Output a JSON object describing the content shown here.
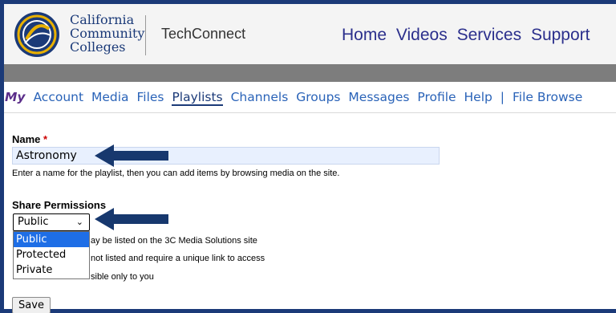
{
  "header": {
    "logo": {
      "lines": [
        "California",
        "Community",
        "Colleges"
      ]
    },
    "brand": "TechConnect",
    "nav": [
      "Home",
      "Videos",
      "Services",
      "Support"
    ]
  },
  "subnav": {
    "my": "My",
    "items": [
      "Account",
      "Media",
      "Files",
      "Playlists",
      "Channels",
      "Groups",
      "Messages",
      "Profile",
      "Help"
    ],
    "separator": "|",
    "trailing": "File Browse",
    "active": "Playlists"
  },
  "form": {
    "name_label": "Name",
    "required_mark": "*",
    "name_value": "Astronomy",
    "name_help": "Enter a name for the playlist, then you can add items by browsing media on the site.",
    "share_label": "Share Permissions",
    "share_selected": "Public",
    "share_options": [
      "Public",
      "Protected",
      "Private"
    ],
    "help_line1_visible": "ay be listed on the 3C Media Solutions site",
    "help_line2_visible": "not listed and require a unique link to access",
    "help_line3_visible": "sible only to you",
    "save_label": "Save"
  },
  "colors": {
    "frame": "#1b3a78",
    "arrow": "#17386e",
    "topnav": "#2b2f8c",
    "subnav": "#2a63b8",
    "selected_option": "#1e6ee6"
  },
  "icons": {
    "logo": "ccc-seal-icon",
    "select_chevron": "chevron-down-icon",
    "annotation": "left-arrow-icon"
  }
}
